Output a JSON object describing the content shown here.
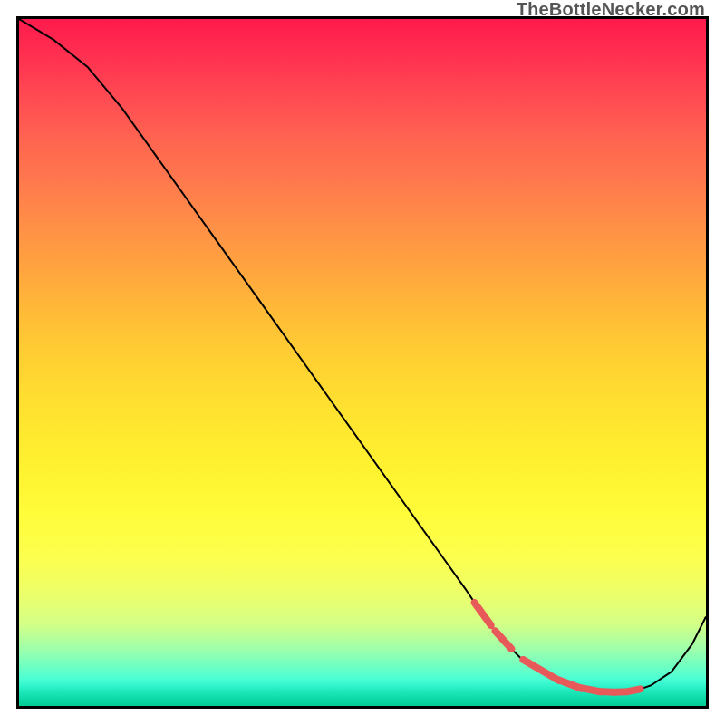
{
  "watermark": "TheBottleNecker.com",
  "chart_data": {
    "type": "line",
    "title": "",
    "xlabel": "",
    "ylabel": "",
    "xlim": [
      0,
      100
    ],
    "ylim": [
      0,
      100
    ],
    "x": [
      0,
      5,
      10,
      15,
      20,
      25,
      30,
      35,
      40,
      45,
      50,
      55,
      60,
      65,
      67,
      70,
      73,
      76,
      79,
      82,
      85,
      88,
      90,
      92,
      95,
      98,
      100
    ],
    "values": [
      100,
      97,
      93,
      87,
      80,
      73,
      66,
      59,
      52,
      45,
      38,
      31,
      24,
      17,
      14,
      10,
      7,
      5,
      3.5,
      2.5,
      2,
      2,
      2.3,
      3,
      5,
      9,
      13
    ],
    "marker_region_x": [
      67,
      90
    ],
    "series_color": "#000000",
    "marker_color": "#e85a5a"
  }
}
